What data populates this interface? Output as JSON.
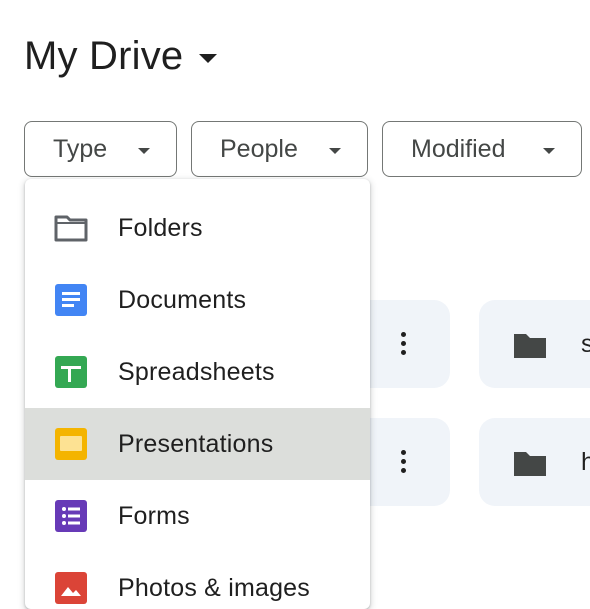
{
  "header": {
    "title": "My Drive",
    "caret_icon": "arrow-drop-down-icon"
  },
  "filters": [
    {
      "label": "Type"
    },
    {
      "label": "People"
    },
    {
      "label": "Modified"
    }
  ],
  "background_items": [
    {
      "name": "s",
      "icon": "folder-icon"
    },
    {
      "name": "h",
      "icon": "folder-icon"
    }
  ],
  "type_menu": {
    "selected": "Presentations",
    "items": [
      {
        "label": "Folders",
        "icon": "folder-outline-icon",
        "color": "#5f6368"
      },
      {
        "label": "Documents",
        "icon": "docs-icon",
        "color": "#4285f4"
      },
      {
        "label": "Spreadsheets",
        "icon": "sheets-icon",
        "color": "#34a853"
      },
      {
        "label": "Presentations",
        "icon": "slides-icon",
        "color": "#f4b400"
      },
      {
        "label": "Forms",
        "icon": "forms-icon",
        "color": "#673ab7"
      },
      {
        "label": "Photos & images",
        "icon": "photos-icon",
        "color": "#db4437"
      }
    ]
  },
  "colors": {
    "menu_selected_bg": "#dcdedb",
    "card_bg": "#f0f4f9",
    "chip_border": "#747775"
  }
}
